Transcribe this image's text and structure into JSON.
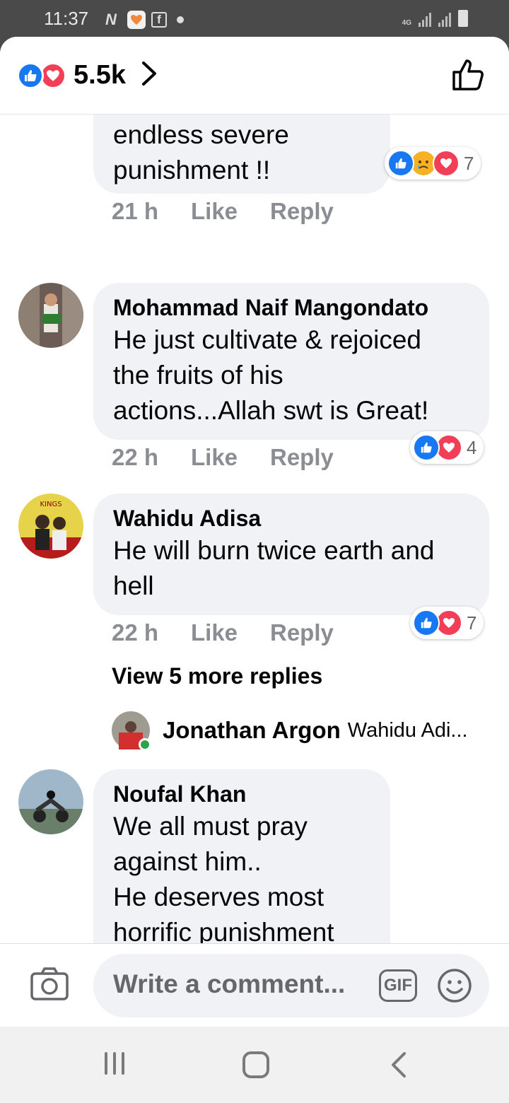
{
  "status_bar": {
    "time": "11:37",
    "network": "4G",
    "left_icons": [
      "n-app-icon",
      "heart-app-icon",
      "facebook-icon",
      "dot-icon"
    ],
    "right_icons": [
      "signal-icon",
      "signal-icon",
      "battery-icon"
    ]
  },
  "header": {
    "reaction_icons": [
      "like-icon",
      "love-icon"
    ],
    "total_reactions": "5.5k",
    "like_icon": "thumbs-up-outline-icon"
  },
  "comments": [
    {
      "author": "",
      "text": "endless severe\npunishment !!",
      "time": "21 h",
      "like_label": "Like",
      "reply_label": "Reply",
      "reactions": [
        "like",
        "sad",
        "love"
      ],
      "reaction_count": "7"
    },
    {
      "author": "Mohammad Naif Mangondato",
      "text": "He just cultivate & rejoiced\nthe fruits of his\nactions...Allah swt is Great!",
      "time": "22 h",
      "like_label": "Like",
      "reply_label": "Reply",
      "reactions": [
        "like",
        "love"
      ],
      "reaction_count": "4"
    },
    {
      "author": "Wahidu Adisa",
      "text": "He will burn twice earth and\nhell",
      "time": "22 h",
      "like_label": "Like",
      "reply_label": "Reply",
      "reactions": [
        "like",
        "love"
      ],
      "reaction_count": "7",
      "view_more": "View 5 more replies",
      "reply_preview": {
        "author": "Jonathan Argon",
        "snippet": "Wahidu Adi..."
      }
    },
    {
      "author": "Noufal Khan",
      "text": "We all must pray\nagainst him..\nHe deserves most\nhorrific punishment\nfrom Allah SWT."
    }
  ],
  "composer": {
    "placeholder": "Write a comment...",
    "gif_label": "GIF",
    "icons": [
      "camera-icon",
      "emoji-icon"
    ]
  },
  "nav_bar": {
    "icons": [
      "recent-apps-icon",
      "home-icon",
      "back-icon"
    ]
  },
  "colors": {
    "like_blue": "#1877f2",
    "love_red": "#f33e58",
    "sad_yellow": "#f7b125",
    "bubble_gray": "#f0f2f5",
    "meta_gray": "#8a8d91"
  }
}
